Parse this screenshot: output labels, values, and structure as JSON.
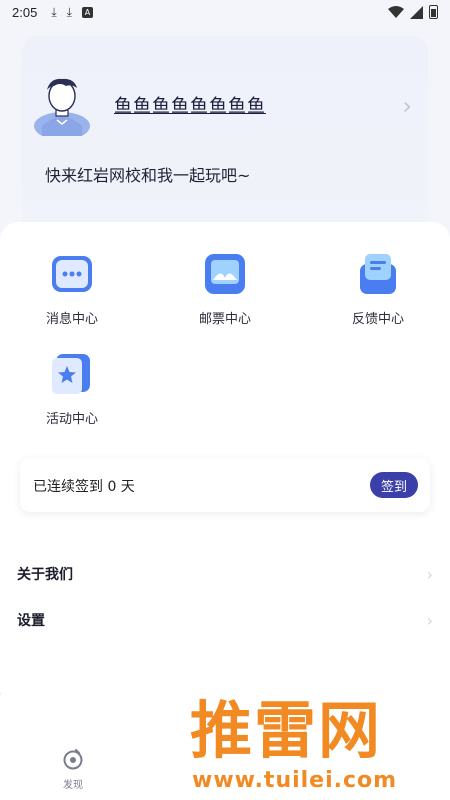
{
  "status_bar": {
    "time": "2:05",
    "icons": [
      "download-icon",
      "download-icon",
      "a-badge-icon",
      "wifi-icon",
      "signal-icon",
      "battery-icon"
    ]
  },
  "profile": {
    "nickname": "鱼鱼鱼鱼鱼鱼鱼鱼",
    "motto": "快来红岩网校和我一起玩吧~",
    "arrow": "›"
  },
  "grid": [
    {
      "label": "消息中心",
      "icon": "message-center-icon"
    },
    {
      "label": "邮票中心",
      "icon": "stamp-center-icon"
    },
    {
      "label": "反馈中心",
      "icon": "feedback-center-icon"
    },
    {
      "label": "活动中心",
      "icon": "activity-center-icon"
    }
  ],
  "checkin": {
    "text": "已连续签到 0 天",
    "button": "签到"
  },
  "menu": [
    {
      "label": "关于我们",
      "arrow": "›"
    },
    {
      "label": "设置",
      "arrow": "›"
    }
  ],
  "tabbar": {
    "label": "发现",
    "icon": "discover-icon"
  },
  "watermark": {
    "brand": "推雷网",
    "url": "www.tuilei.com"
  },
  "colors": {
    "accent": "#3b3fa8",
    "icon_blue": "#4a7df0",
    "watermark": "#f28a24"
  }
}
